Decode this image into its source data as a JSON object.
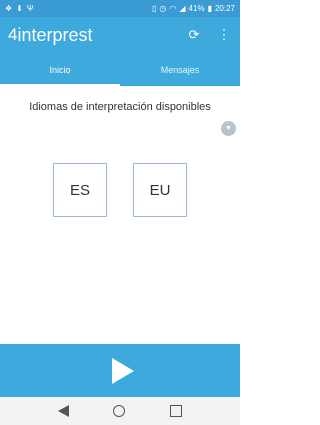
{
  "status_bar": {
    "left_icons": [
      "dropbox-icon",
      "download-icon",
      "usb-icon"
    ],
    "right_icons": [
      "vibrate-icon",
      "alarm-icon",
      "wifi-icon",
      "signal-icon"
    ],
    "battery": "41%",
    "battery_icon": "battery-icon",
    "time": "20:27"
  },
  "app_bar": {
    "logo_mark": "4",
    "logo_text": "interprest",
    "actions": [
      "refresh-icon",
      "more-vertical-icon"
    ]
  },
  "tabs": [
    {
      "label": "Inicio",
      "active": true
    },
    {
      "label": "Mensajes",
      "active": false
    }
  ],
  "main": {
    "heading": "Idiomas de interpretación disponibles",
    "scroll_down_icon": "arrow-down-icon",
    "languages": [
      "ES",
      "EU"
    ]
  },
  "play_bar": {
    "icon": "play-icon"
  },
  "nav_bar": {
    "buttons": [
      "back-icon",
      "home-icon",
      "recents-icon"
    ]
  },
  "colors": {
    "status_bar": "#3a9bd5",
    "primary": "#3ea9dd",
    "lang_border": "#9eb8d3",
    "nav_bar": "#f2f2f2"
  }
}
